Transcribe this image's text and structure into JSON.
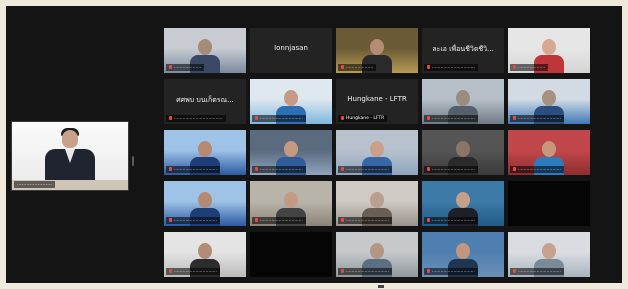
{
  "meeting": {
    "active_speaker": {
      "name": "......................"
    },
    "tiles": [
      {
        "name": "...................",
        "display_name": "",
        "scene": "office-blue"
      },
      {
        "name": "",
        "display_name": "Ionnjasan",
        "scene": "name-only"
      },
      {
        "name": "...................",
        "display_name": "",
        "scene": "studio-gold"
      },
      {
        "name": "..............................",
        "display_name": "ละเอ เพื่อนชีวิตชีวิ...",
        "scene": "name-only"
      },
      {
        "name": "...................",
        "display_name": "",
        "scene": "woman-red"
      },
      {
        "name": "..................................",
        "display_name": "ศศพบ บนเก็ตรณ...",
        "scene": "name-only"
      },
      {
        "name": "..............................",
        "display_name": "",
        "scene": "group-screen"
      },
      {
        "name": "Hungkane - LFTR",
        "display_name": "Hungkane - LFTR",
        "scene": "name-only"
      },
      {
        "name": "..............................",
        "display_name": "",
        "scene": "office-desks"
      },
      {
        "name": "..............................",
        "display_name": "",
        "scene": "banner-room"
      },
      {
        "name": "..............................",
        "display_name": "",
        "scene": "blue-banner"
      },
      {
        "name": "..............................",
        "display_name": "",
        "scene": "man-blue"
      },
      {
        "name": "..............................",
        "display_name": "",
        "scene": "man-glasses"
      },
      {
        "name": "..............................",
        "display_name": "",
        "scene": "dim-room"
      },
      {
        "name": "..............................",
        "display_name": "",
        "scene": "red-room"
      },
      {
        "name": "..............................",
        "display_name": "",
        "scene": "blue-banner"
      },
      {
        "name": "..............................",
        "display_name": "",
        "scene": "woman-office"
      },
      {
        "name": "..............................",
        "display_name": "",
        "scene": "meeting-room"
      },
      {
        "name": "..............................",
        "display_name": "",
        "scene": "man-mask"
      },
      {
        "name": "",
        "display_name": "",
        "scene": "black"
      },
      {
        "name": "..............................",
        "display_name": "",
        "scene": "man-white"
      },
      {
        "name": "",
        "display_name": "",
        "scene": "black"
      },
      {
        "name": "..............................",
        "display_name": "",
        "scene": "office-small"
      },
      {
        "name": "..............................",
        "display_name": "",
        "scene": "man-smile"
      },
      {
        "name": "..............................",
        "display_name": "",
        "scene": "window-room"
      }
    ]
  },
  "colors": {
    "background": "#141414",
    "page": "#efe9dc",
    "active_border": "#d9c52a",
    "muted_mic": "#e34a4a"
  }
}
